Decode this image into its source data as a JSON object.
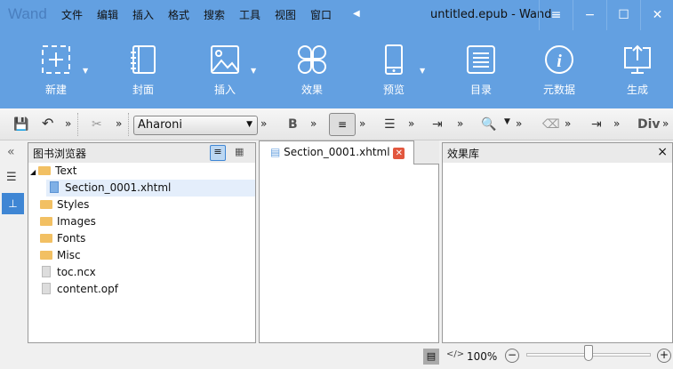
{
  "app": {
    "logo": "Wand",
    "title": "untitled.epub - Wand"
  },
  "menu": [
    "文件",
    "编辑",
    "插入",
    "格式",
    "搜索",
    "工具",
    "视图",
    "窗口"
  ],
  "ribbon": [
    {
      "label": "新建",
      "icon": "new-icon"
    },
    {
      "label": "封面",
      "icon": "cover-icon"
    },
    {
      "label": "插入",
      "icon": "image-icon"
    },
    {
      "label": "效果",
      "icon": "effects-icon"
    },
    {
      "label": "预览",
      "icon": "phone-icon"
    },
    {
      "label": "目录",
      "icon": "toc-icon"
    },
    {
      "label": "元数据",
      "icon": "info-icon"
    },
    {
      "label": "生成",
      "icon": "export-icon"
    }
  ],
  "toolbar": {
    "font": "Aharoni",
    "more": "»",
    "bold": "B",
    "div": "Div"
  },
  "browser": {
    "title": "图书浏览器",
    "items": [
      {
        "label": "Text",
        "type": "folder"
      },
      {
        "label": "Section_0001.xhtml",
        "type": "page"
      },
      {
        "label": "Styles",
        "type": "folder"
      },
      {
        "label": "Images",
        "type": "folder"
      },
      {
        "label": "Fonts",
        "type": "folder"
      },
      {
        "label": "Misc",
        "type": "folder"
      },
      {
        "label": "toc.ncx",
        "type": "file"
      },
      {
        "label": "content.opf",
        "type": "file"
      }
    ]
  },
  "editor": {
    "tab": "Section_0001.xhtml"
  },
  "effects": {
    "title": "效果库",
    "close": "×"
  },
  "status": {
    "zoom": "100%",
    "zoom_slider": 0.5
  }
}
